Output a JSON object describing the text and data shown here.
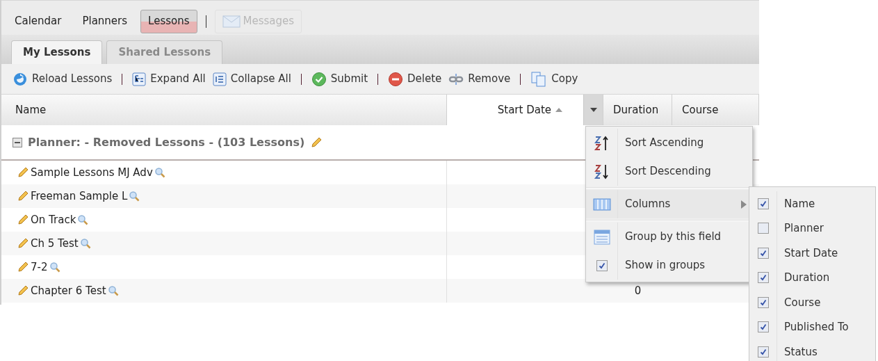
{
  "nav": [
    {
      "label": "Calendar",
      "selected": false,
      "disabled": false
    },
    {
      "label": "Planners",
      "selected": false,
      "disabled": false
    },
    {
      "label": "Lessons",
      "selected": true,
      "disabled": false
    },
    {
      "label": "Messages",
      "selected": false,
      "disabled": true,
      "kind": "mail"
    }
  ],
  "tabs": [
    {
      "label": "My Lessons",
      "selected": true
    },
    {
      "label": "Shared Lessons",
      "selected": false
    }
  ],
  "toolbar": [
    [
      {
        "label": "Reload Lessons"
      }
    ],
    [
      {
        "label": "Expand All"
      },
      {
        "label": "Collapse All"
      }
    ],
    [
      {
        "label": "Submit"
      }
    ],
    [
      {
        "label": "Delete"
      },
      {
        "label": "Remove"
      }
    ],
    [
      {
        "label": "Copy"
      }
    ]
  ],
  "columns": [
    {
      "label": "Name",
      "sorted_ascending": false,
      "menu_open": false
    },
    {
      "label": "Start Date",
      "sorted_ascending": true,
      "menu_open": true
    },
    {
      "label": "Duration",
      "sorted_ascending": false,
      "menu_open": false
    },
    {
      "label": "Course",
      "sorted_ascending": false,
      "menu_open": false
    }
  ],
  "group": {
    "label": "Planner: - Removed Lessons - (103 Lessons)",
    "expanded": true
  },
  "rows": [
    {
      "name": "Sample Lessons MJ Adv"
    },
    {
      "name": "Freeman Sample L"
    },
    {
      "name": "On Track"
    },
    {
      "name": "Ch 5 Test"
    },
    {
      "name": "7-2"
    },
    {
      "name": "Chapter 6 Test",
      "duration": "0"
    }
  ],
  "menu": [
    {
      "kind": "item",
      "label": "Sort Ascending"
    },
    {
      "kind": "item",
      "label": "Sort Descending"
    },
    {
      "kind": "separator"
    },
    {
      "kind": "submenu",
      "label": "Columns",
      "expanded": true
    },
    {
      "kind": "separator"
    },
    {
      "kind": "item",
      "label": "Group by this field"
    },
    {
      "kind": "checkbox",
      "label": "Show in groups",
      "checked": true
    }
  ],
  "submenu": [
    {
      "label": "Name",
      "checked": true
    },
    {
      "label": "Planner",
      "checked": false
    },
    {
      "label": "Start Date",
      "checked": true
    },
    {
      "label": "Duration",
      "checked": true
    },
    {
      "label": "Course",
      "checked": true
    },
    {
      "label": "Published To",
      "checked": true
    },
    {
      "label": "Status",
      "checked": true
    }
  ]
}
